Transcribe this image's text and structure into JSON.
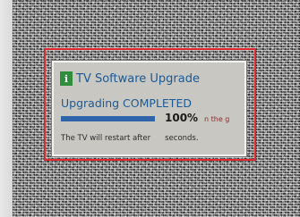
{
  "dialog": {
    "title": "TV Software Upgrade",
    "status": "Upgrading COMPLETED",
    "progress_percent": 100,
    "progress_label": "100%",
    "side_note": "n the g",
    "restart_prefix": "The TV will restart after",
    "restart_suffix": "seconds."
  },
  "colors": {
    "highlight_frame": "#e0262f",
    "title_text": "#1c5a96",
    "progress_fill": "#2f64a8",
    "icon_bg": "#2f8e3c",
    "dialog_bg": "#c9c7c1"
  },
  "icons": {
    "dialog_icon": "info-icon",
    "dialog_icon_glyph": "i"
  }
}
